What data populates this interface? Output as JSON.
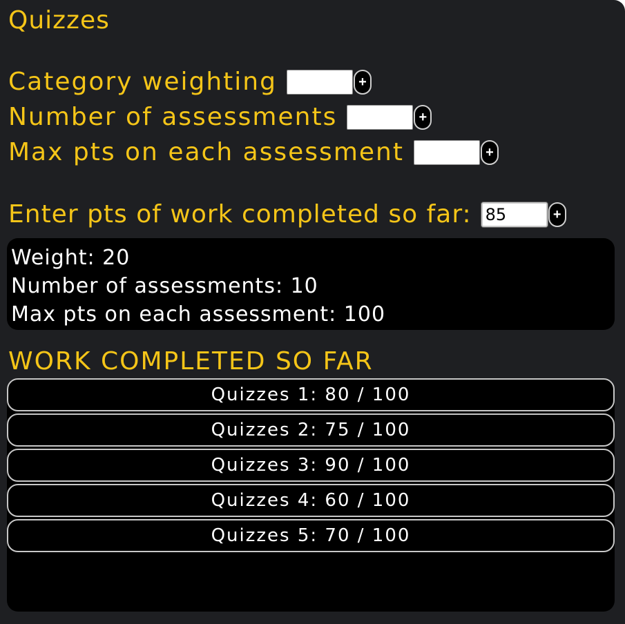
{
  "page": {
    "title": "Quizzes"
  },
  "form": {
    "category_weighting": {
      "label": "Category weighting",
      "value": ""
    },
    "num_assessments": {
      "label": "Number of assessments",
      "value": ""
    },
    "max_pts": {
      "label": "Max pts on each assessment",
      "value": ""
    },
    "pts_completed": {
      "label": "Enter pts of work completed so far:",
      "value": "85"
    },
    "plus_label": "+"
  },
  "summary": {
    "weight": "Weight: 20",
    "num_assessments": "Number of assessments: 10",
    "max_pts": "Max pts on each assessment: 100"
  },
  "work": {
    "heading": "WORK COMPLETED SO FAR",
    "items": [
      {
        "label": "Quizzes 1: 80 / 100"
      },
      {
        "label": "Quizzes 2: 75 / 100"
      },
      {
        "label": "Quizzes 3: 90 / 100"
      },
      {
        "label": "Quizzes 4: 60 / 100"
      },
      {
        "label": "Quizzes 5: 70 / 100"
      }
    ]
  },
  "colors": {
    "accent": "#f5c518",
    "background": "#1e1f22",
    "panel": "#000000"
  }
}
